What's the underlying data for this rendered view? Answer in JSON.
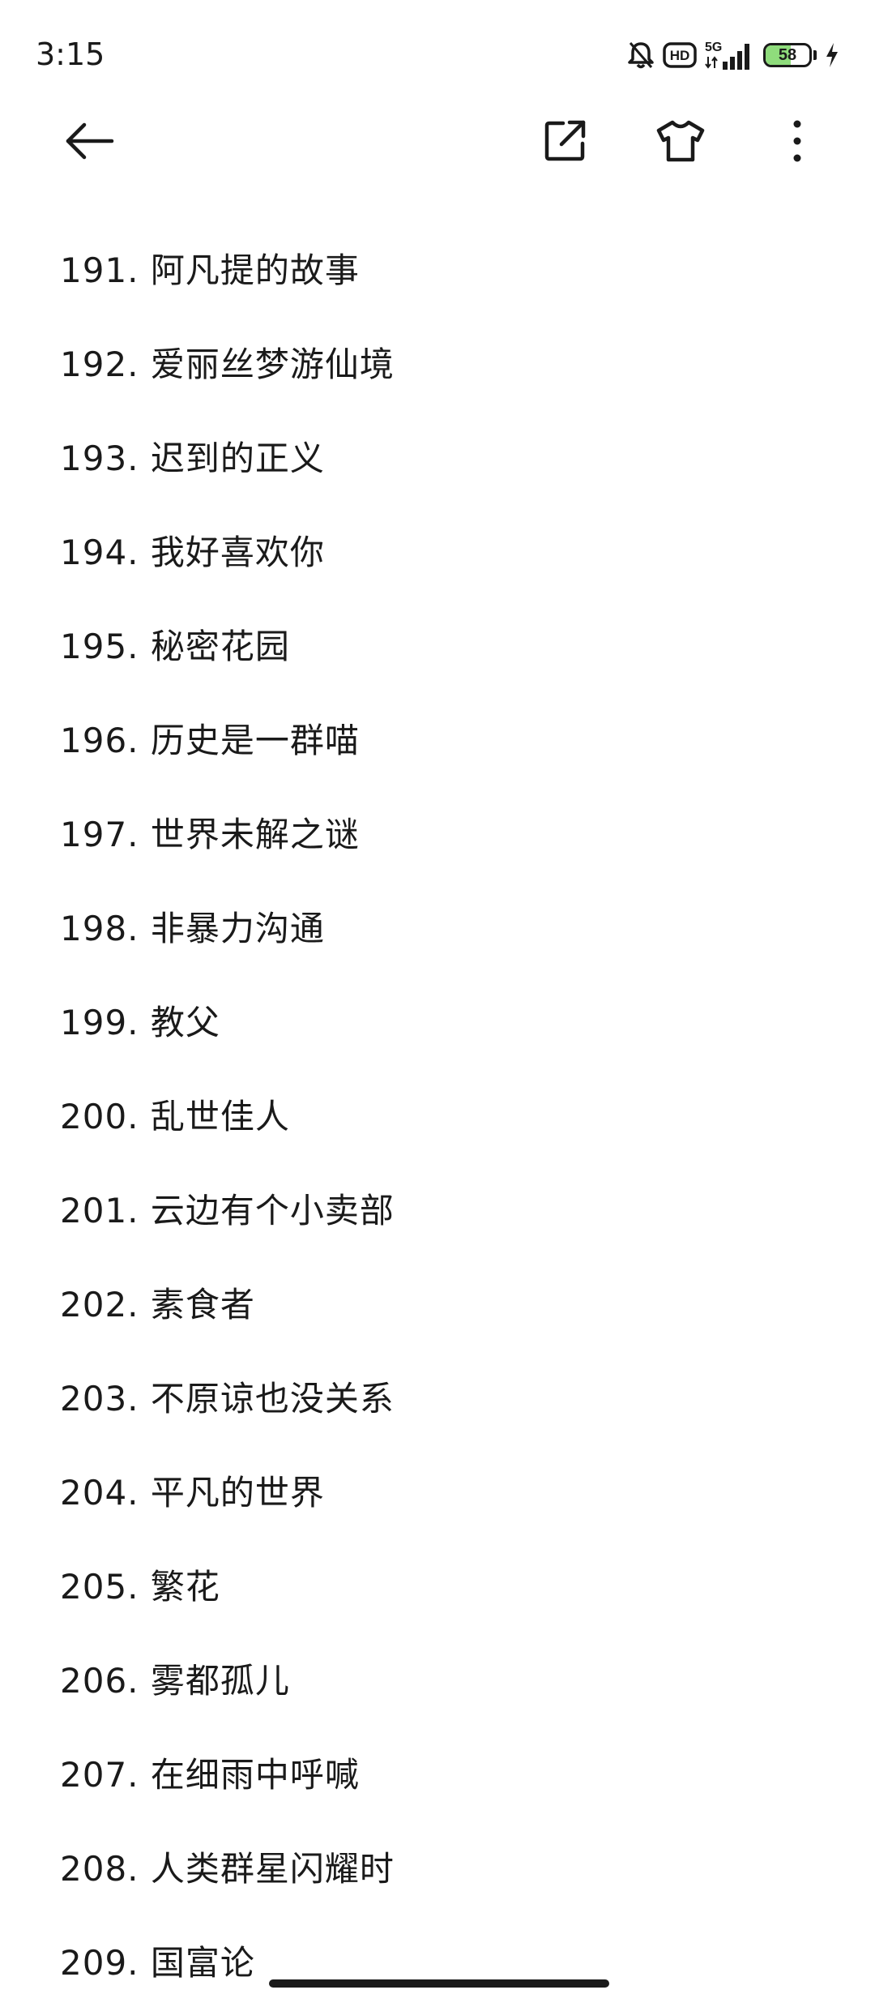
{
  "status": {
    "time": "3:15",
    "network": "5G",
    "hd": "HD",
    "battery_percent": 58,
    "battery_label": "58",
    "icons": [
      "alarm-icon",
      "hd-icon",
      "signal-5g-icon",
      "battery-icon",
      "charging-icon"
    ]
  },
  "toolbar": {
    "icons": [
      "back-arrow-icon",
      "share-icon",
      "tshirt-icon",
      "more-vertical-icon"
    ]
  },
  "list": {
    "items": [
      "191. 阿凡提的故事",
      "192. 爱丽丝梦游仙境",
      "193. 迟到的正义",
      "194. 我好喜欢你",
      "195. 秘密花园",
      "196. 历史是一群喵",
      "197. 世界未解之谜",
      "198. 非暴力沟通",
      "199. 教父",
      "200. 乱世佳人",
      "201. 云边有个小卖部",
      "202. 素食者",
      "203. 不原谅也没关系",
      "204. 平凡的世界",
      "205. 繁花",
      "206. 雾都孤儿",
      "207. 在细雨中呼喊",
      "208. 人类群星闪耀时",
      "209. 国富论"
    ]
  },
  "colors": {
    "text": "#1a1a1a",
    "background": "#ffffff",
    "battery_fill": "#8fdc7c"
  }
}
